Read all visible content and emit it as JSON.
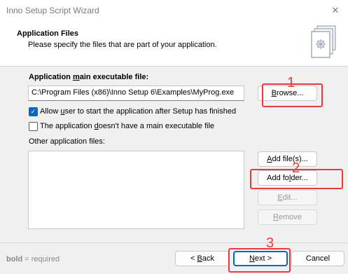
{
  "window": {
    "title": "Inno Setup Script Wizard",
    "close_glyph": "✕"
  },
  "header": {
    "heading": "Application Files",
    "subheading": "Please specify the files that are part of your application."
  },
  "exe": {
    "label_pre": "Application ",
    "label_acc": "m",
    "label_post": "ain executable file:",
    "value": "C:\\Program Files (x86)\\Inno Setup 6\\Examples\\MyProg.exe",
    "browse_acc": "B",
    "browse_rest": "rowse..."
  },
  "options": {
    "allow_pre": "Allow ",
    "allow_acc": "u",
    "allow_post": "ser to start the application after Setup has finished",
    "allow_checked": true,
    "noexe_pre": "The application ",
    "noexe_acc": "d",
    "noexe_post": "oesn't have a main executable file",
    "noexe_checked": false
  },
  "other_files": {
    "label": "Other application files:",
    "items": [],
    "add_files_acc": "A",
    "add_files_rest": "dd file(s)...",
    "add_folder_pre": "Add fo",
    "add_folder_acc": "l",
    "add_folder_post": "der...",
    "edit_acc": "E",
    "edit_rest": "dit...",
    "remove_acc": "R",
    "remove_rest": "emove"
  },
  "footer": {
    "legend_bold": "bold",
    "legend_rest": " = required",
    "back_pre": "< ",
    "back_acc": "B",
    "back_post": "ack",
    "next_acc": "N",
    "next_post": "ext >",
    "cancel": "Cancel"
  },
  "annotations": {
    "n1": "1",
    "n2": "2",
    "n3": "3",
    "color": "#e43b3b"
  },
  "icons": [
    "close-icon",
    "wizard-book-icon",
    "checkmark-icon"
  ]
}
